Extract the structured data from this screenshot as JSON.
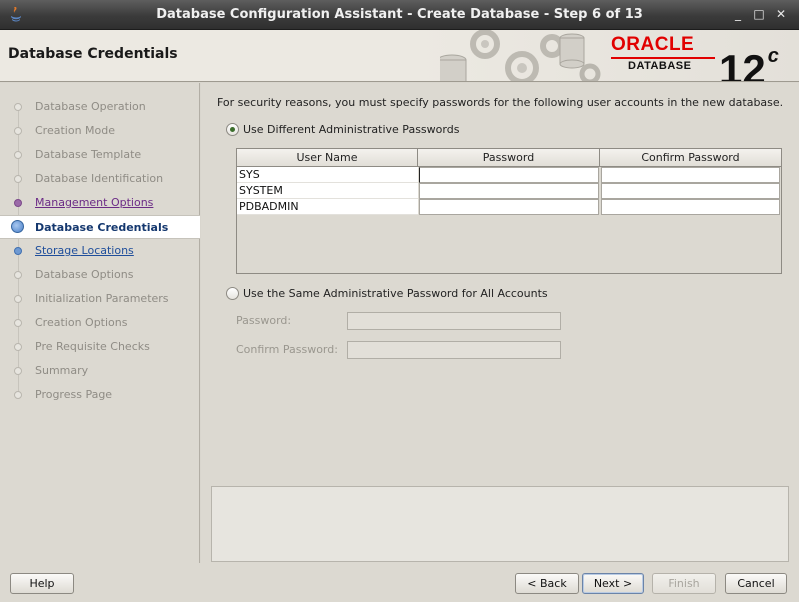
{
  "window": {
    "title": "Database Configuration Assistant - Create Database - Step 6 of 13",
    "minimize_glyph": "_",
    "maximize_glyph": "□",
    "close_glyph": "✕"
  },
  "banner": {
    "heading": "Database Credentials",
    "brand": "ORACLE",
    "product": "DATABASE",
    "version": "12",
    "version_suffix": "c"
  },
  "nav": {
    "items": [
      {
        "label": "Database Operation",
        "state": "pending"
      },
      {
        "label": "Creation Mode",
        "state": "pending"
      },
      {
        "label": "Database Template",
        "state": "pending"
      },
      {
        "label": "Database Identification",
        "state": "pending"
      },
      {
        "label": "Management Options",
        "state": "visited"
      },
      {
        "label": "Database Credentials",
        "state": "current"
      },
      {
        "label": "Storage Locations",
        "state": "link"
      },
      {
        "label": "Database Options",
        "state": "pending"
      },
      {
        "label": "Initialization Parameters",
        "state": "pending"
      },
      {
        "label": "Creation Options",
        "state": "pending"
      },
      {
        "label": "Pre Requisite Checks",
        "state": "pending"
      },
      {
        "label": "Summary",
        "state": "pending"
      },
      {
        "label": "Progress Page",
        "state": "pending"
      }
    ]
  },
  "main": {
    "intro": "For security reasons, you must specify passwords for the following user accounts in the new database.",
    "option_different": "Use Different Administrative Passwords",
    "option_same": "Use the Same Administrative Password for All Accounts",
    "selected_option": "different",
    "table": {
      "headers": [
        "User Name",
        "Password",
        "Confirm Password"
      ],
      "rows": [
        {
          "user": "SYS",
          "password": "",
          "confirm": ""
        },
        {
          "user": "SYSTEM",
          "password": "",
          "confirm": ""
        },
        {
          "user": "PDBADMIN",
          "password": "",
          "confirm": ""
        }
      ]
    },
    "password_label": "Password:",
    "confirm_label": "Confirm Password:",
    "password_value": "",
    "confirm_value": ""
  },
  "footer": {
    "help": "Help",
    "back": "< Back",
    "next": "Next >",
    "finish": "Finish",
    "cancel": "Cancel"
  },
  "colors": {
    "oracle_red": "#e10000",
    "visited_link": "#6b2b86",
    "link": "#1f4e9b"
  }
}
